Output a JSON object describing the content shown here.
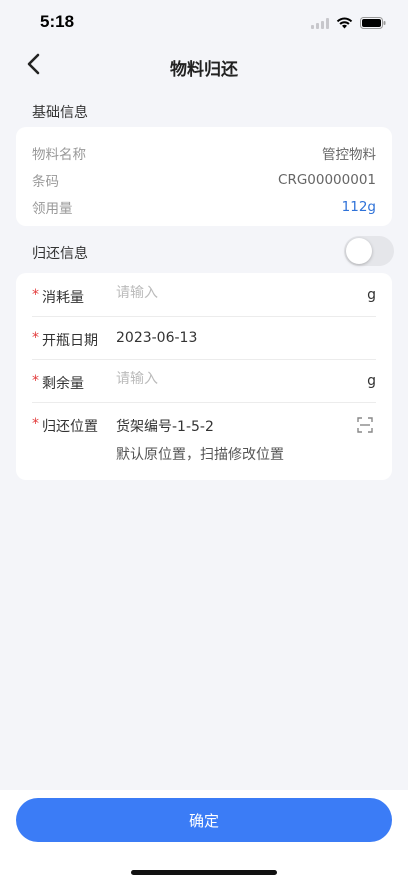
{
  "status_bar": {
    "time": "5:18"
  },
  "nav": {
    "title": "物料归还",
    "back_icon": "chevron-left-icon"
  },
  "basic_info": {
    "section_title": "基础信息",
    "rows": [
      {
        "label": "物料名称",
        "value": "管控物料"
      },
      {
        "label": "条码",
        "value": "CRG00000001"
      },
      {
        "label": "领用量",
        "value": "112g"
      }
    ]
  },
  "return_info": {
    "section_title": "归还信息",
    "toggle_on": false,
    "required_mark": "*",
    "consumption": {
      "label": "消耗量",
      "placeholder": "请输入",
      "unit": "g"
    },
    "open_date": {
      "label": "开瓶日期",
      "value": "2023-06-13"
    },
    "remaining": {
      "label": "剩余量",
      "placeholder": "请输入",
      "unit": "g"
    },
    "location": {
      "label": "归还位置",
      "value": "货架编号-1-5-2",
      "hint": "默认原位置，扫描修改位置",
      "icon": "scan-icon"
    }
  },
  "footer": {
    "confirm_label": "确定"
  },
  "colors": {
    "primary": "#3b7cf6",
    "required": "#e23b3b",
    "link_value": "#2f72d8",
    "background": "#f4f5f9"
  }
}
